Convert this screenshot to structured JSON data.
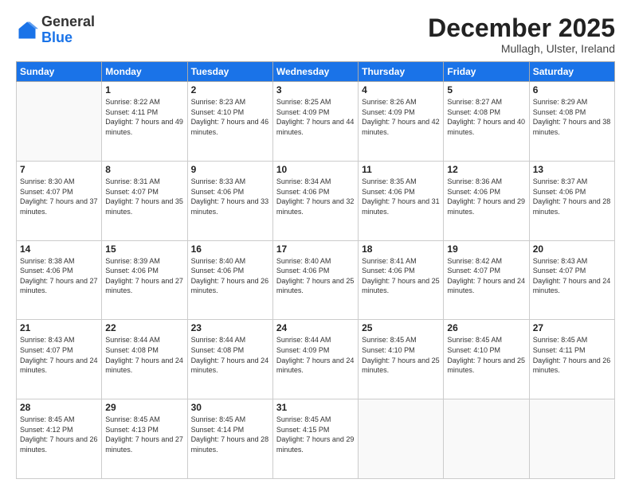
{
  "header": {
    "logo": {
      "general": "General",
      "blue": "Blue"
    },
    "title": "December 2025",
    "location": "Mullagh, Ulster, Ireland"
  },
  "weekdays": [
    "Sunday",
    "Monday",
    "Tuesday",
    "Wednesday",
    "Thursday",
    "Friday",
    "Saturday"
  ],
  "weeks": [
    [
      {
        "day": "",
        "empty": true
      },
      {
        "day": "1",
        "sunrise": "8:22 AM",
        "sunset": "4:11 PM",
        "daylight": "7 hours and 49 minutes."
      },
      {
        "day": "2",
        "sunrise": "8:23 AM",
        "sunset": "4:10 PM",
        "daylight": "7 hours and 46 minutes."
      },
      {
        "day": "3",
        "sunrise": "8:25 AM",
        "sunset": "4:09 PM",
        "daylight": "7 hours and 44 minutes."
      },
      {
        "day": "4",
        "sunrise": "8:26 AM",
        "sunset": "4:09 PM",
        "daylight": "7 hours and 42 minutes."
      },
      {
        "day": "5",
        "sunrise": "8:27 AM",
        "sunset": "4:08 PM",
        "daylight": "7 hours and 40 minutes."
      },
      {
        "day": "6",
        "sunrise": "8:29 AM",
        "sunset": "4:08 PM",
        "daylight": "7 hours and 38 minutes."
      }
    ],
    [
      {
        "day": "7",
        "sunrise": "8:30 AM",
        "sunset": "4:07 PM",
        "daylight": "7 hours and 37 minutes."
      },
      {
        "day": "8",
        "sunrise": "8:31 AM",
        "sunset": "4:07 PM",
        "daylight": "7 hours and 35 minutes."
      },
      {
        "day": "9",
        "sunrise": "8:33 AM",
        "sunset": "4:06 PM",
        "daylight": "7 hours and 33 minutes."
      },
      {
        "day": "10",
        "sunrise": "8:34 AM",
        "sunset": "4:06 PM",
        "daylight": "7 hours and 32 minutes."
      },
      {
        "day": "11",
        "sunrise": "8:35 AM",
        "sunset": "4:06 PM",
        "daylight": "7 hours and 31 minutes."
      },
      {
        "day": "12",
        "sunrise": "8:36 AM",
        "sunset": "4:06 PM",
        "daylight": "7 hours and 29 minutes."
      },
      {
        "day": "13",
        "sunrise": "8:37 AM",
        "sunset": "4:06 PM",
        "daylight": "7 hours and 28 minutes."
      }
    ],
    [
      {
        "day": "14",
        "sunrise": "8:38 AM",
        "sunset": "4:06 PM",
        "daylight": "7 hours and 27 minutes."
      },
      {
        "day": "15",
        "sunrise": "8:39 AM",
        "sunset": "4:06 PM",
        "daylight": "7 hours and 27 minutes."
      },
      {
        "day": "16",
        "sunrise": "8:40 AM",
        "sunset": "4:06 PM",
        "daylight": "7 hours and 26 minutes."
      },
      {
        "day": "17",
        "sunrise": "8:40 AM",
        "sunset": "4:06 PM",
        "daylight": "7 hours and 25 minutes."
      },
      {
        "day": "18",
        "sunrise": "8:41 AM",
        "sunset": "4:06 PM",
        "daylight": "7 hours and 25 minutes."
      },
      {
        "day": "19",
        "sunrise": "8:42 AM",
        "sunset": "4:07 PM",
        "daylight": "7 hours and 24 minutes."
      },
      {
        "day": "20",
        "sunrise": "8:43 AM",
        "sunset": "4:07 PM",
        "daylight": "7 hours and 24 minutes."
      }
    ],
    [
      {
        "day": "21",
        "sunrise": "8:43 AM",
        "sunset": "4:07 PM",
        "daylight": "7 hours and 24 minutes."
      },
      {
        "day": "22",
        "sunrise": "8:44 AM",
        "sunset": "4:08 PM",
        "daylight": "7 hours and 24 minutes."
      },
      {
        "day": "23",
        "sunrise": "8:44 AM",
        "sunset": "4:08 PM",
        "daylight": "7 hours and 24 minutes."
      },
      {
        "day": "24",
        "sunrise": "8:44 AM",
        "sunset": "4:09 PM",
        "daylight": "7 hours and 24 minutes."
      },
      {
        "day": "25",
        "sunrise": "8:45 AM",
        "sunset": "4:10 PM",
        "daylight": "7 hours and 25 minutes."
      },
      {
        "day": "26",
        "sunrise": "8:45 AM",
        "sunset": "4:10 PM",
        "daylight": "7 hours and 25 minutes."
      },
      {
        "day": "27",
        "sunrise": "8:45 AM",
        "sunset": "4:11 PM",
        "daylight": "7 hours and 26 minutes."
      }
    ],
    [
      {
        "day": "28",
        "sunrise": "8:45 AM",
        "sunset": "4:12 PM",
        "daylight": "7 hours and 26 minutes."
      },
      {
        "day": "29",
        "sunrise": "8:45 AM",
        "sunset": "4:13 PM",
        "daylight": "7 hours and 27 minutes."
      },
      {
        "day": "30",
        "sunrise": "8:45 AM",
        "sunset": "4:14 PM",
        "daylight": "7 hours and 28 minutes."
      },
      {
        "day": "31",
        "sunrise": "8:45 AM",
        "sunset": "4:15 PM",
        "daylight": "7 hours and 29 minutes."
      },
      {
        "day": "",
        "empty": true
      },
      {
        "day": "",
        "empty": true
      },
      {
        "day": "",
        "empty": true
      }
    ]
  ]
}
